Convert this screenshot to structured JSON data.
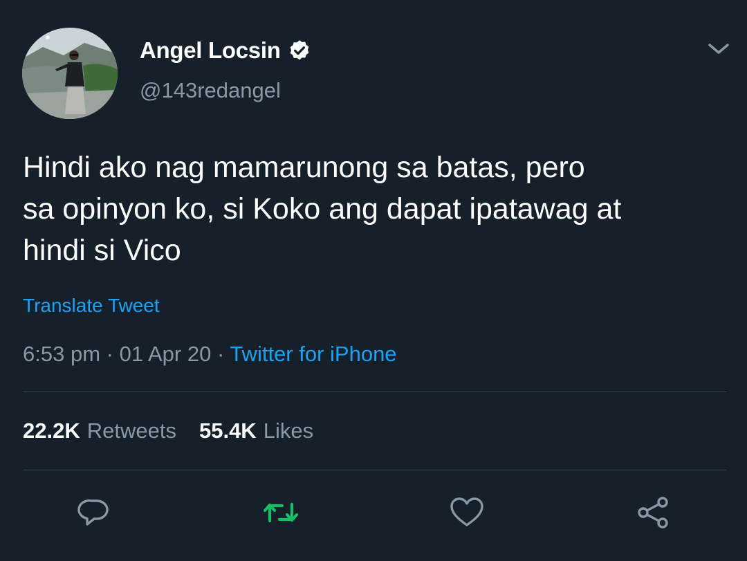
{
  "author": {
    "name": "Angel Locsin",
    "handle": "@143redangel",
    "verified": true
  },
  "tweet": {
    "text": "Hindi ako nag mamarunong sa batas, pero\nsa opinyon ko, si Koko ang dapat ipatawag at\nhindi si Vico",
    "translate_label": "Translate Tweet",
    "time": "6:53 pm",
    "date": "01 Apr 20",
    "separator": "·",
    "source": "Twitter for iPhone"
  },
  "stats": {
    "retweets_count": "22.2K",
    "retweets_label": "Retweets",
    "likes_count": "55.4K",
    "likes_label": "Likes"
  },
  "icons": {
    "menu": "chevron-down-icon",
    "verified": "verified-badge-icon",
    "reply": "reply-icon",
    "retweet": "retweet-icon",
    "like": "heart-icon",
    "share": "share-icon"
  },
  "colors": {
    "background": "#15202b",
    "text_primary": "#ffffff",
    "text_secondary": "#8899a6",
    "link": "#1da1f2",
    "retweet_active": "#17bf63",
    "divider": "#38444d"
  }
}
